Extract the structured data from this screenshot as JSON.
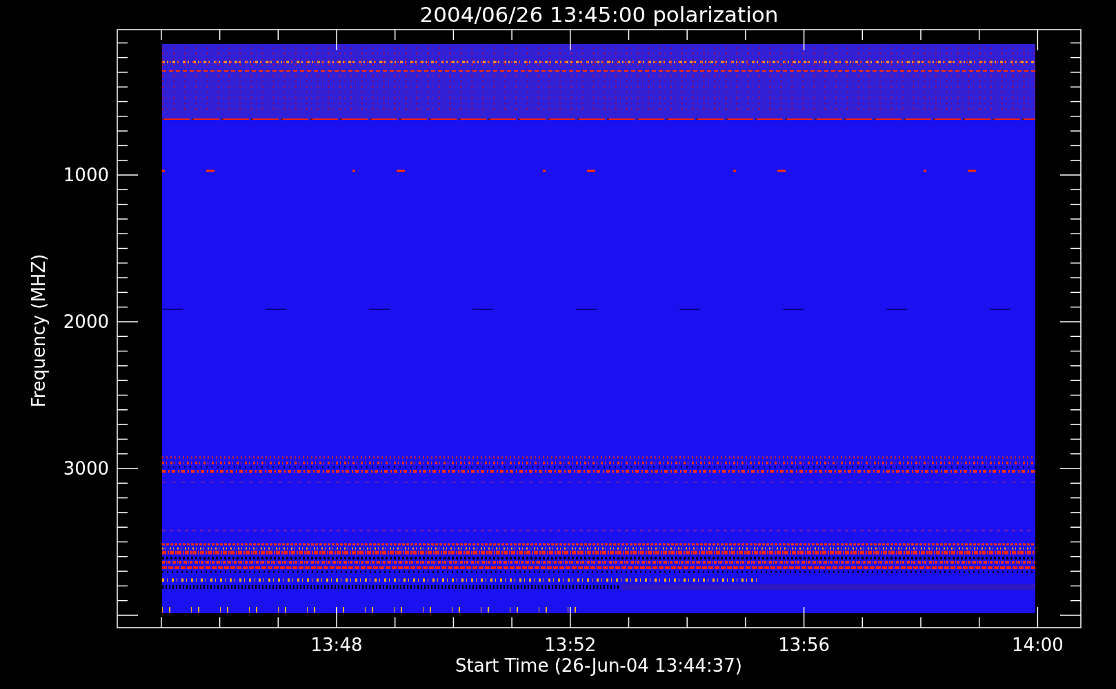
{
  "title": "2004/06/26 13:45:00 polarization",
  "xlabel": "Start Time (26-Jun-04 13:44:37)",
  "ylabel": "Frequency (MHZ)",
  "xticks": [
    "13:48",
    "13:52",
    "13:56",
    "14:00"
  ],
  "yticks": [
    "1000",
    "2000",
    "3000"
  ]
}
